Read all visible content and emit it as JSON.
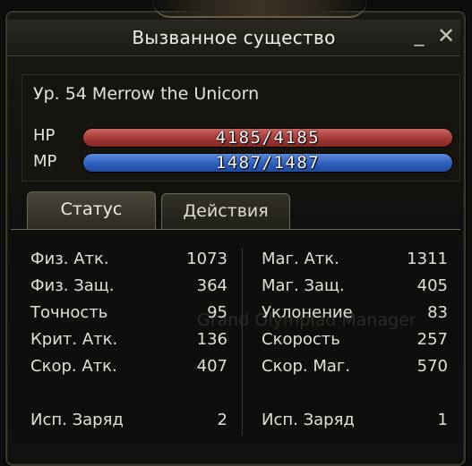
{
  "window": {
    "title": "Вызванное существо",
    "minimize_glyph": "_",
    "close_glyph": "✕"
  },
  "pet": {
    "name": "Ур. 54 Merrow the Unicorn",
    "hp_label": "HP",
    "hp_text": "4185/4185",
    "hp_fraction": 1.0,
    "mp_label": "MP",
    "mp_text": "1487/1487",
    "mp_fraction": 1.0
  },
  "tabs": {
    "status": "Статус",
    "actions": "Действия"
  },
  "stats_left": [
    {
      "label": "Физ. Атк.",
      "value": "1073"
    },
    {
      "label": "Физ. Защ.",
      "value": "364"
    },
    {
      "label": "Точность",
      "value": "95"
    },
    {
      "label": "Крит. Атк.",
      "value": "136"
    },
    {
      "label": "Скор. Атк.",
      "value": "407"
    },
    {
      "label": "Исп. Заряд",
      "value": "2"
    }
  ],
  "stats_right": [
    {
      "label": "Маг. Атк.",
      "value": "1311"
    },
    {
      "label": "Маг. Защ.",
      "value": "405"
    },
    {
      "label": "Уклонение",
      "value": "83"
    },
    {
      "label": "Скорость",
      "value": "257"
    },
    {
      "label": "Скор. Маг.",
      "value": "570"
    },
    {
      "label": "Исп. Заряд",
      "value": "1"
    }
  ],
  "watermark": "Grand Olympiad Manager",
  "colors": {
    "hp_bar": "#a33a36",
    "mp_bar": "#2d5fbe"
  }
}
